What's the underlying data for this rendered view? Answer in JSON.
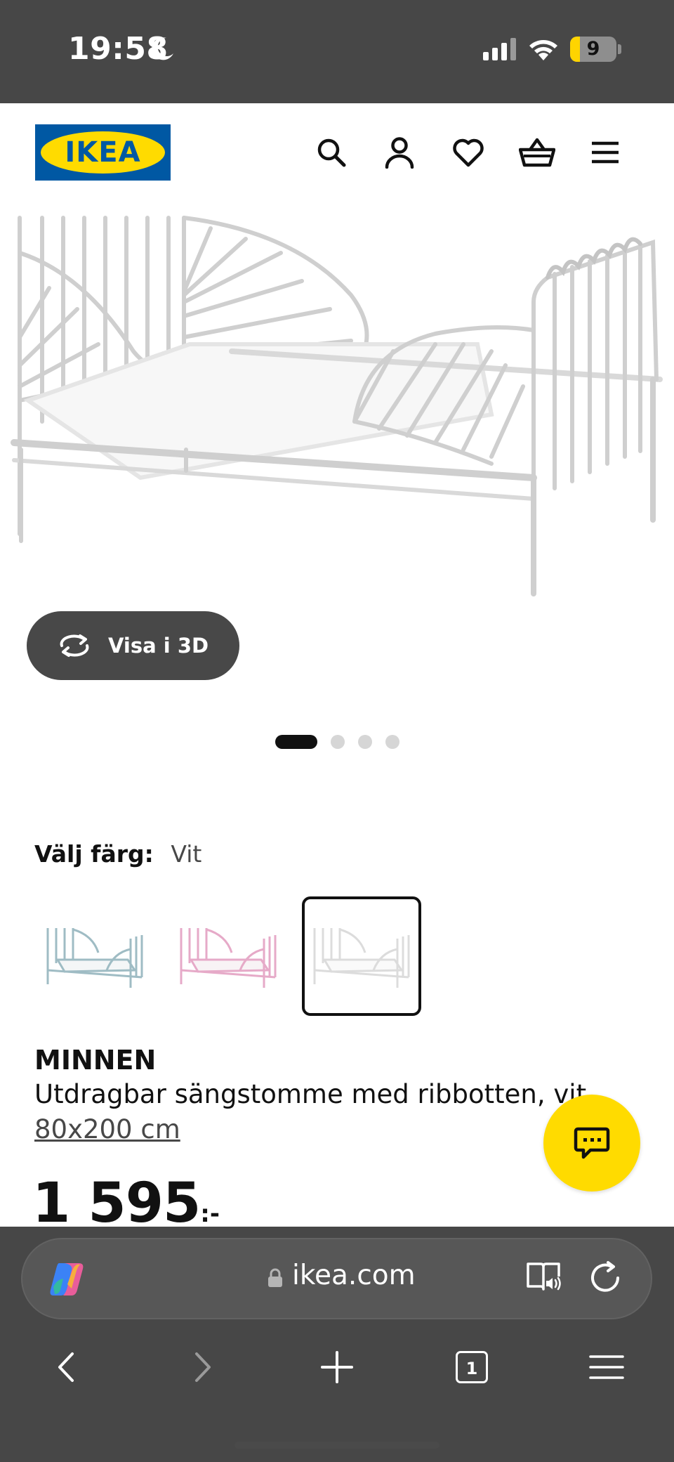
{
  "status_bar": {
    "time": "19:58",
    "battery_level": "9",
    "icons": [
      "moon-icon",
      "signal-icon",
      "wifi-icon",
      "battery-icon"
    ]
  },
  "header": {
    "logo_text": "IKEA",
    "icons": [
      "search-icon",
      "account-icon",
      "heart-icon",
      "basket-icon",
      "menu-icon"
    ]
  },
  "hero": {
    "view_3d_label": "Visa i 3D",
    "carousel_count": 4,
    "carousel_active_index": 0
  },
  "colour": {
    "label": "Välj färg:",
    "selected_value": "Vit",
    "swatches": [
      {
        "name": "blue",
        "color": "#9fbcc4"
      },
      {
        "name": "pink",
        "color": "#e6aac8"
      },
      {
        "name": "white",
        "color": "#dcdcdc",
        "selected": true
      }
    ]
  },
  "product": {
    "name": "MINNEN",
    "description": "Utdragbar sängstomme med ribbotten, vit",
    "size": "80x200 cm",
    "price": "1 595",
    "price_suffix": ":-"
  },
  "browser": {
    "url": "ikea.com",
    "tab_count": "1"
  },
  "colors": {
    "status_bar_bg": "#474747",
    "ikea_blue": "#0058a3",
    "ikea_yellow": "#ffdb00",
    "button_dark": "#484848"
  }
}
